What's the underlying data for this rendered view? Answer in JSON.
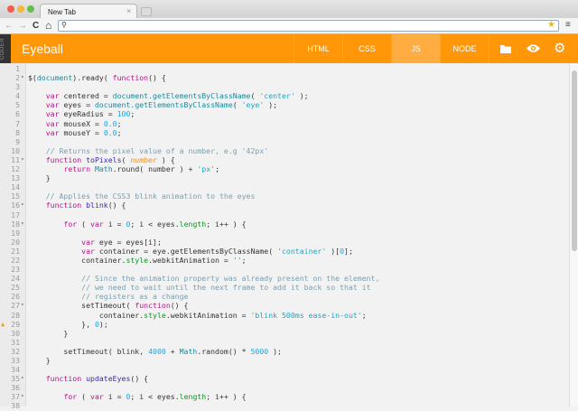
{
  "browser": {
    "tab_title": "New Tab",
    "close": "×",
    "back": "←",
    "forward": "→",
    "reload": "C",
    "home": "⌂",
    "search_glyph": "⚲",
    "star": "★",
    "menu": "≡"
  },
  "app": {
    "sidebar_label": "CODER",
    "title": "Eyeball",
    "tabs": [
      {
        "label": "HTML"
      },
      {
        "label": "CSS"
      },
      {
        "label": "JS",
        "active": true
      },
      {
        "label": "NODE"
      }
    ],
    "icons": [
      "folder-icon",
      "eye-icon",
      "gear-icon"
    ]
  },
  "editor": {
    "fold_lines": [
      2,
      11,
      16,
      18,
      27,
      35,
      37
    ],
    "warning_lines": [
      29
    ],
    "lines": [
      [],
      [
        [
          "t",
          "$("
        ],
        [
          "d",
          "document"
        ],
        [
          "t",
          ").ready( "
        ],
        [
          "k",
          "function"
        ],
        [
          "t",
          "() {"
        ]
      ],
      [],
      [
        [
          "t",
          "    "
        ],
        [
          "k",
          "var"
        ],
        [
          "t",
          " centered = "
        ],
        [
          "d",
          "document.getElementsByClassName"
        ],
        [
          "t",
          "( "
        ],
        [
          "s",
          "'center'"
        ],
        [
          "t",
          " );"
        ]
      ],
      [
        [
          "t",
          "    "
        ],
        [
          "k",
          "var"
        ],
        [
          "t",
          " eyes = "
        ],
        [
          "d",
          "document.getElementsByClassName"
        ],
        [
          "t",
          "( "
        ],
        [
          "s",
          "'eye'"
        ],
        [
          "t",
          " );"
        ]
      ],
      [
        [
          "t",
          "    "
        ],
        [
          "k",
          "var"
        ],
        [
          "t",
          " eyeRadius = "
        ],
        [
          "n",
          "100"
        ],
        [
          "t",
          ";"
        ]
      ],
      [
        [
          "t",
          "    "
        ],
        [
          "k",
          "var"
        ],
        [
          "t",
          " mouseX = "
        ],
        [
          "n",
          "0.0"
        ],
        [
          "t",
          ";"
        ]
      ],
      [
        [
          "t",
          "    "
        ],
        [
          "k",
          "var"
        ],
        [
          "t",
          " mouseY = "
        ],
        [
          "n",
          "0.0"
        ],
        [
          "t",
          ";"
        ]
      ],
      [],
      [
        [
          "t",
          "    "
        ],
        [
          "c",
          "// Returns the pixel value of a number, e.g '42px'"
        ]
      ],
      [
        [
          "t",
          "    "
        ],
        [
          "k",
          "function"
        ],
        [
          "t",
          " "
        ],
        [
          "f",
          "toPixels"
        ],
        [
          "t",
          "( "
        ],
        [
          "p",
          "number"
        ],
        [
          "t",
          " ) {"
        ]
      ],
      [
        [
          "t",
          "        "
        ],
        [
          "k",
          "return"
        ],
        [
          "t",
          " "
        ],
        [
          "d",
          "Math"
        ],
        [
          "t",
          ".round( number ) + "
        ],
        [
          "s",
          "'px'"
        ],
        [
          "t",
          ";"
        ]
      ],
      [
        [
          "t",
          "    }"
        ]
      ],
      [],
      [
        [
          "t",
          "    "
        ],
        [
          "c",
          "// Applies the CSS3 blink animation to the eyes"
        ]
      ],
      [
        [
          "t",
          "    "
        ],
        [
          "k",
          "function"
        ],
        [
          "t",
          " "
        ],
        [
          "f",
          "blink"
        ],
        [
          "t",
          "() {"
        ]
      ],
      [],
      [
        [
          "t",
          "        "
        ],
        [
          "k",
          "for"
        ],
        [
          "t",
          " ( "
        ],
        [
          "k",
          "var"
        ],
        [
          "t",
          " i = "
        ],
        [
          "n",
          "0"
        ],
        [
          "t",
          "; i < eyes."
        ],
        [
          "g",
          "length"
        ],
        [
          "t",
          "; i++ ) {"
        ]
      ],
      [],
      [
        [
          "t",
          "            "
        ],
        [
          "k",
          "var"
        ],
        [
          "t",
          " eye = eyes[i];"
        ]
      ],
      [
        [
          "t",
          "            "
        ],
        [
          "k",
          "var"
        ],
        [
          "t",
          " container = eye.getElementsByClassName( "
        ],
        [
          "s",
          "'container'"
        ],
        [
          "t",
          " )["
        ],
        [
          "n",
          "0"
        ],
        [
          "t",
          "];"
        ]
      ],
      [
        [
          "t",
          "            container."
        ],
        [
          "g",
          "style"
        ],
        [
          "t",
          ".webkitAnimation = "
        ],
        [
          "s",
          "''"
        ],
        [
          "t",
          ";"
        ]
      ],
      [],
      [
        [
          "t",
          "            "
        ],
        [
          "c",
          "// Since the animation property was already present on the element,"
        ]
      ],
      [
        [
          "t",
          "            "
        ],
        [
          "c",
          "// we need to wait until the next frame to add it back so that it"
        ]
      ],
      [
        [
          "t",
          "            "
        ],
        [
          "c",
          "// registers as a change"
        ]
      ],
      [
        [
          "t",
          "            setTimeout( "
        ],
        [
          "k",
          "function"
        ],
        [
          "t",
          "() {"
        ]
      ],
      [
        [
          "t",
          "                container."
        ],
        [
          "g",
          "style"
        ],
        [
          "t",
          ".webkitAnimation = "
        ],
        [
          "s",
          "'blink 500ms ease-in-out'"
        ],
        [
          "t",
          ";"
        ]
      ],
      [
        [
          "t",
          "            }, "
        ],
        [
          "n",
          "0"
        ],
        [
          "t",
          ");"
        ]
      ],
      [
        [
          "t",
          "        }"
        ]
      ],
      [],
      [
        [
          "t",
          "        setTimeout( blink, "
        ],
        [
          "n",
          "4000"
        ],
        [
          "t",
          " + "
        ],
        [
          "d",
          "Math"
        ],
        [
          "t",
          ".random() * "
        ],
        [
          "n",
          "5000"
        ],
        [
          "t",
          " );"
        ]
      ],
      [
        [
          "t",
          "    }"
        ]
      ],
      [],
      [
        [
          "t",
          "    "
        ],
        [
          "k",
          "function"
        ],
        [
          "t",
          " "
        ],
        [
          "f",
          "updateEyes"
        ],
        [
          "t",
          "() {"
        ]
      ],
      [],
      [
        [
          "t",
          "        "
        ],
        [
          "k",
          "for"
        ],
        [
          "t",
          " ( "
        ],
        [
          "k",
          "var"
        ],
        [
          "t",
          " i = "
        ],
        [
          "n",
          "0"
        ],
        [
          "t",
          "; i < eyes."
        ],
        [
          "g",
          "length"
        ],
        [
          "t",
          "; i++ ) {"
        ]
      ],
      []
    ]
  }
}
